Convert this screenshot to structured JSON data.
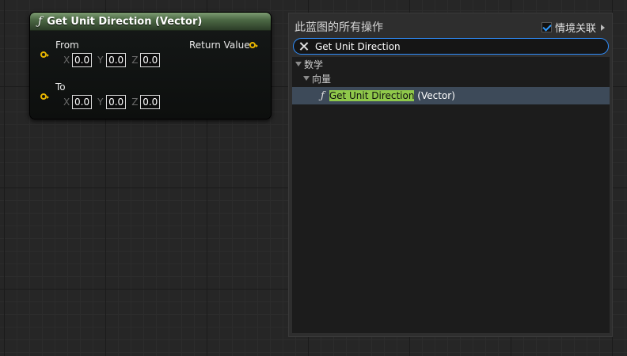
{
  "node": {
    "title": "Get Unit Direction (Vector)",
    "func_glyph": "ƒ",
    "pins": {
      "from_label": "From",
      "to_label": "To",
      "return_label": "Return Value"
    },
    "from": {
      "x_label": "X",
      "x": "0.0",
      "y_label": "Y",
      "y": "0.0",
      "z_label": "Z",
      "z": "0.0"
    },
    "to": {
      "x_label": "X",
      "x": "0.0",
      "y_label": "Y",
      "y": "0.0",
      "z_label": "Z",
      "z": "0.0"
    },
    "colors": {
      "pin": "#e6b400",
      "header": "#4d6a45"
    }
  },
  "menu": {
    "title": "此蓝图的所有操作",
    "context_label": "情境关联",
    "context_checked": true,
    "search": {
      "value": "Get Unit Direction",
      "placeholder": ""
    },
    "tree": {
      "category": "数学",
      "subcategory": "向量",
      "result": {
        "glyph": "ƒ",
        "match": "Get Unit Direction",
        "rest": " (Vector)"
      }
    },
    "colors": {
      "highlight": "#8fc84a",
      "selected_row": "#3d4a59",
      "focus": "#2f8fff"
    }
  }
}
